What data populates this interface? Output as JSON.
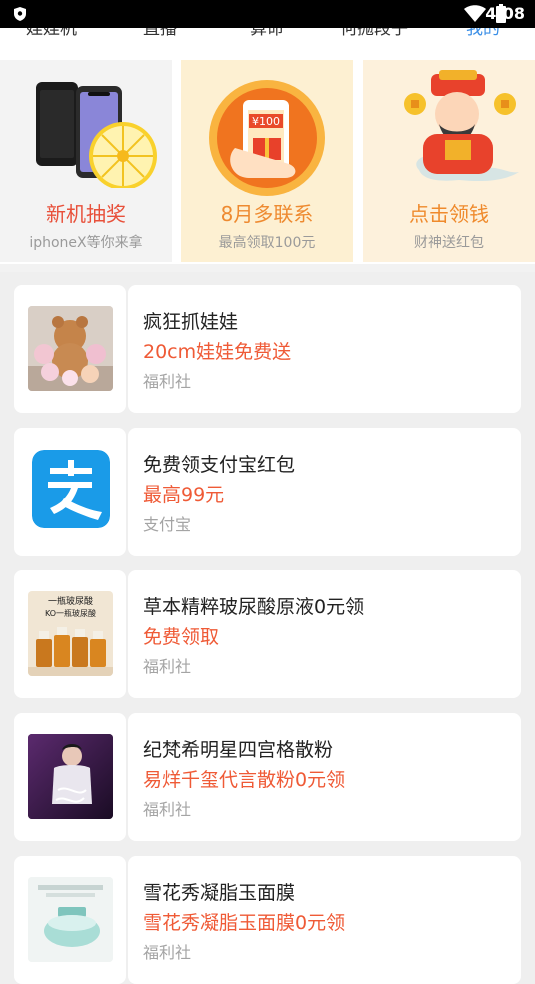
{
  "status_bar": {
    "time": "4:08"
  },
  "tabs": [
    "娃娃机",
    "直播",
    "算命",
    "何抛段子",
    "我的"
  ],
  "banners": [
    {
      "title": "新机抽奖",
      "subtitle": "iphoneX等你来拿",
      "title_color": "#e8503a",
      "bg": "#f3f3f3"
    },
    {
      "title": "8月多联系",
      "subtitle": "最高领取100元",
      "title_color": "#ee8a30",
      "bg": "#fdf0d2"
    },
    {
      "title": "点击领钱",
      "subtitle": "财神送红包",
      "title_color": "#ef8a2c",
      "bg": "#fdf1dc"
    }
  ],
  "banner_icons": {
    "phone_prize": "phone-wheel-icon",
    "money_gift": "red-envelope-icon",
    "wealth_god": "wealth-god-icon"
  },
  "cards": [
    {
      "title": "疯狂抓娃娃",
      "highlight": "20cm娃娃免费送",
      "source": "福利社",
      "thumb": "plush-toys-thumb"
    },
    {
      "title": "免费领支付宝红包",
      "highlight": "最高99元",
      "source": "支付宝",
      "thumb": "alipay-logo-icon"
    },
    {
      "title": "草本精粹玻尿酸原液0元领",
      "highlight": "免费领取",
      "source": "福利社",
      "thumb": "serum-bottles-thumb",
      "thumb_text": [
        "一瓶玻尿酸",
        "KO一瓶玻尿酸"
      ]
    },
    {
      "title": "纪梵希明星四宫格散粉",
      "highlight": "易烊千玺代言散粉0元领",
      "source": "福利社",
      "thumb": "celebrity-poster-thumb"
    },
    {
      "title": "雪花秀凝脂玉面膜",
      "highlight": "雪花秀凝脂玉面膜0元领",
      "source": "福利社",
      "thumb": "face-cream-thumb"
    }
  ],
  "colors": {
    "accent_tab": "#3a8ee6",
    "highlight_red": "#ef5a36",
    "alipay_blue": "#1a9be8"
  }
}
